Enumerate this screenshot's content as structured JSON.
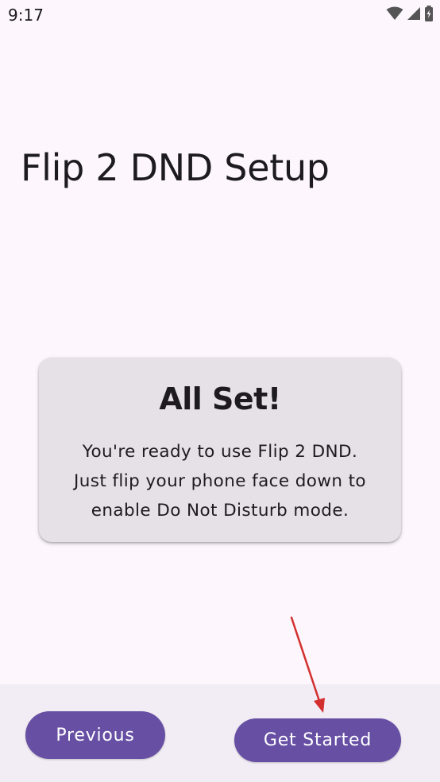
{
  "status_bar": {
    "time": "9:17",
    "icons": [
      "wifi-icon",
      "cellular-signal-icon",
      "battery-charging-icon"
    ]
  },
  "page": {
    "title": "Flip 2 DND Setup"
  },
  "card": {
    "title": "All Set!",
    "body": "You're ready to use Flip 2 DND.\nJust flip your phone face down to\nenable Do Not Disturb mode."
  },
  "navigation": {
    "previous_label": "Previous",
    "get_started_label": "Get Started"
  },
  "colors": {
    "background": "#FDF7FD",
    "card_background": "#E6E1E6",
    "bottom_bar_background": "#F2ECF4",
    "button_primary": "#6750A4",
    "annotation_arrow": "#D32F2F"
  }
}
